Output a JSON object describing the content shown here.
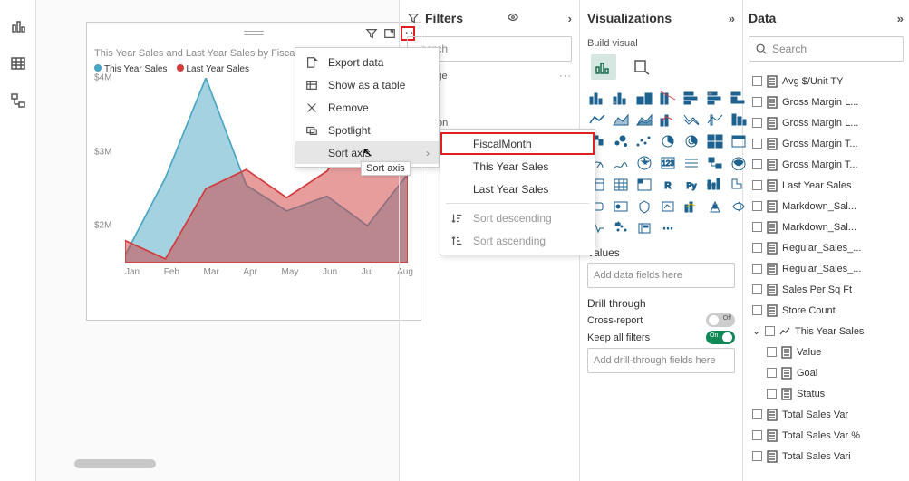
{
  "left_rail": {
    "icons": [
      "report-view",
      "table-view",
      "model-view"
    ]
  },
  "visual": {
    "title": "This Year Sales and Last Year Sales by FiscalMonth",
    "legend": {
      "a": "This Year Sales",
      "b": "Last Year Sales"
    },
    "more_icon": "···"
  },
  "chart_data": {
    "type": "area",
    "categories": [
      "Jan",
      "Feb",
      "Mar",
      "Apr",
      "May",
      "Jun",
      "Jul",
      "Aug"
    ],
    "series": [
      {
        "name": "This Year Sales",
        "color": "#4aa5c4",
        "values": [
          1600000,
          2650000,
          4000000,
          2550000,
          2200000,
          2400000,
          2000000,
          2700000
        ]
      },
      {
        "name": "Last Year Sales",
        "color": "#d23b3b",
        "values": [
          1800000,
          1550000,
          2500000,
          2760000,
          2380000,
          2740000,
          3520000,
          3020000
        ]
      }
    ],
    "ylabel": "",
    "xlabel": "",
    "ylim": [
      1500000,
      4000000
    ],
    "yticks": [
      {
        "v": 2000000,
        "label": "$2M"
      },
      {
        "v": 3000000,
        "label": "$3M"
      },
      {
        "v": 4000000,
        "label": "$4M"
      }
    ]
  },
  "context_menu": {
    "items": [
      {
        "id": "export-data",
        "label": "Export data"
      },
      {
        "id": "show-as-table",
        "label": "Show as a table"
      },
      {
        "id": "remove",
        "label": "Remove"
      },
      {
        "id": "spotlight",
        "label": "Spotlight"
      },
      {
        "id": "sort-axis",
        "label": "Sort axis",
        "submenu": true,
        "hover": true
      }
    ],
    "submenu": [
      {
        "id": "fiscalmonth",
        "label": "FiscalMonth",
        "boxed": true
      },
      {
        "id": "this-year-sales",
        "label": "This Year Sales"
      },
      {
        "id": "last-year-sales",
        "label": "Last Year Sales"
      },
      {
        "id": "sort-desc",
        "label": "Sort descending",
        "disabled": true
      },
      {
        "id": "sort-asc",
        "label": "Sort ascending",
        "disabled": true
      }
    ],
    "tooltip": "Sort axis"
  },
  "filters": {
    "title": "Filters",
    "search_placeholder": "Search",
    "search_partial": "earch",
    "section_page": "this page",
    "filters_on_partial": "Filters on",
    "add_partial": "A"
  },
  "viz": {
    "title": "Visualizations",
    "sub": "Build visual",
    "values_head": "Values",
    "values_placeholder": "Add data fields here",
    "drill_head": "Drill through",
    "cross_report": "Cross-report",
    "cross_report_state": "Off",
    "keep_filters": "Keep all filters",
    "keep_filters_state": "On",
    "drill_placeholder": "Add drill-through fields here"
  },
  "data": {
    "title": "Data",
    "search_placeholder": "Search",
    "fields": [
      {
        "name": "Avg $/Unit TY",
        "type": "calc"
      },
      {
        "name": "Gross Margin L...",
        "type": "calc"
      },
      {
        "name": "Gross Margin L...",
        "type": "calc"
      },
      {
        "name": "Gross Margin T...",
        "type": "calc"
      },
      {
        "name": "Gross Margin T...",
        "type": "calc"
      },
      {
        "name": "Last Year Sales",
        "type": "calc"
      },
      {
        "name": "Markdown_Sal...",
        "type": "calc"
      },
      {
        "name": "Markdown_Sal...",
        "type": "calc"
      },
      {
        "name": "Regular_Sales_...",
        "type": "calc"
      },
      {
        "name": "Regular_Sales_...",
        "type": "calc"
      },
      {
        "name": "Sales Per Sq Ft",
        "type": "calc"
      },
      {
        "name": "Store Count",
        "type": "calc"
      },
      {
        "name": "This Year Sales",
        "type": "kpi",
        "expanded": true,
        "children": [
          {
            "name": "Value",
            "type": "calc"
          },
          {
            "name": "Goal",
            "type": "calc"
          },
          {
            "name": "Status",
            "type": "calc"
          }
        ]
      },
      {
        "name": "Total Sales Var",
        "type": "calc"
      },
      {
        "name": "Total Sales Var %",
        "type": "calc"
      },
      {
        "name": "Total Sales Vari",
        "type": "calc"
      }
    ]
  }
}
